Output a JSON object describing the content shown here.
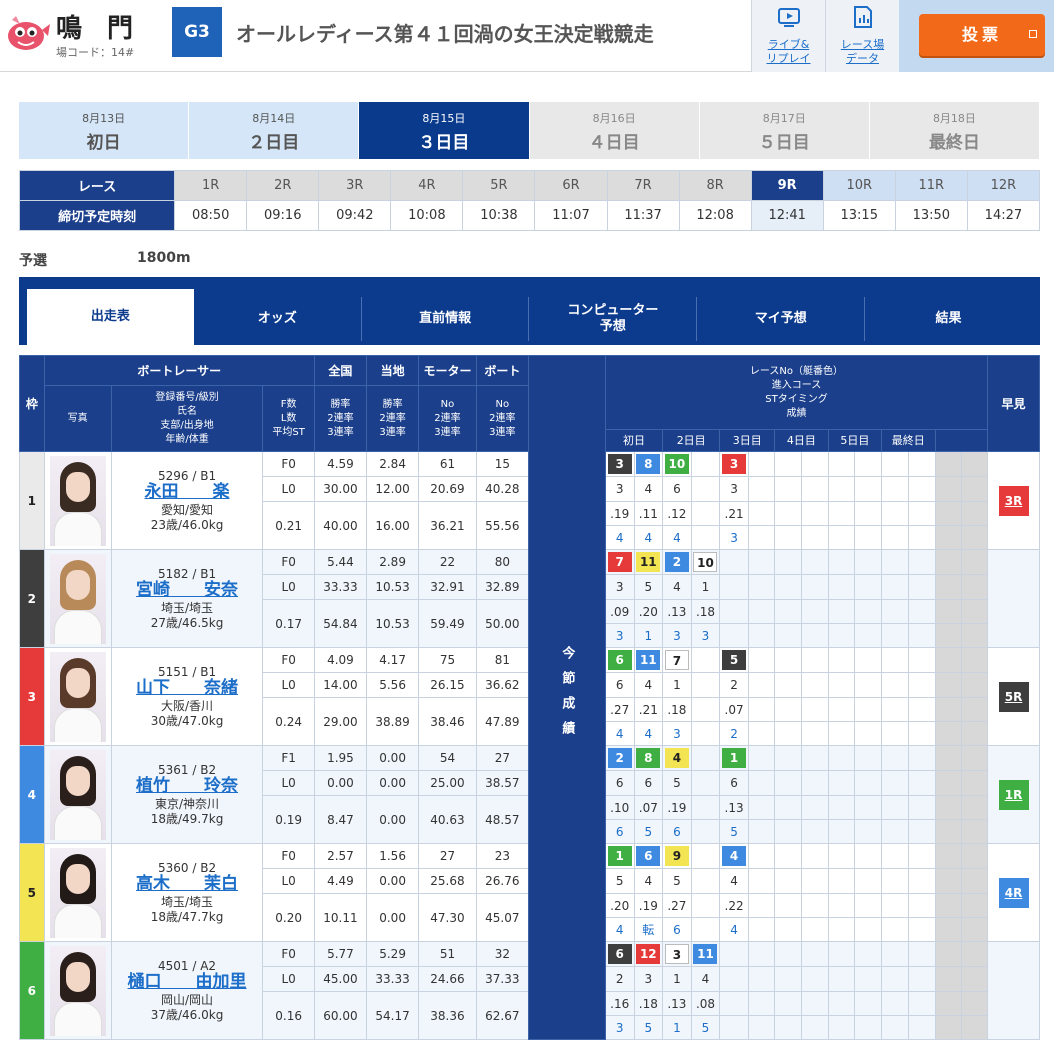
{
  "header": {
    "venue": "鳴 門",
    "venue_code": "場コード：14#",
    "grade": "G3",
    "race_title": "オールレディース第４１回渦の女王決定戦競走",
    "live_label1": "ライブ&",
    "live_label2": "リプレイ",
    "data_label1": "レース場",
    "data_label2": "データ",
    "vote_label": "投票"
  },
  "days": [
    {
      "date": "8月13日",
      "name": "初日",
      "state": "past"
    },
    {
      "date": "8月14日",
      "name": "２日目",
      "state": "past"
    },
    {
      "date": "8月15日",
      "name": "３日目",
      "state": "cur"
    },
    {
      "date": "8月16日",
      "name": "４日目",
      "state": "fut"
    },
    {
      "date": "8月17日",
      "name": "５日目",
      "state": "fut"
    },
    {
      "date": "8月18日",
      "name": "最終日",
      "state": "fut"
    }
  ],
  "races": {
    "race_label": "レース",
    "time_label": "締切予定時刻",
    "list": [
      {
        "r": "1R",
        "t": "08:50",
        "s": "past"
      },
      {
        "r": "2R",
        "t": "09:16",
        "s": "past"
      },
      {
        "r": "3R",
        "t": "09:42",
        "s": "past"
      },
      {
        "r": "4R",
        "t": "10:08",
        "s": "past"
      },
      {
        "r": "5R",
        "t": "10:38",
        "s": "past"
      },
      {
        "r": "6R",
        "t": "11:07",
        "s": "past"
      },
      {
        "r": "7R",
        "t": "11:37",
        "s": "past"
      },
      {
        "r": "8R",
        "t": "12:08",
        "s": "past"
      },
      {
        "r": "9R",
        "t": "12:41",
        "s": "cur"
      },
      {
        "r": "10R",
        "t": "13:15",
        "s": "fu"
      },
      {
        "r": "11R",
        "t": "13:50",
        "s": "fu"
      },
      {
        "r": "12R",
        "t": "14:27",
        "s": "fu"
      }
    ]
  },
  "race_info": {
    "type": "予選",
    "distance": "1800m"
  },
  "tabs": [
    "出走表",
    "オッズ",
    "直前情報",
    "コンピューター\n予想",
    "マイ予想",
    "結果"
  ],
  "table_head": {
    "waku": "枠",
    "boatracer": "ボートレーサー",
    "photo": "写真",
    "reg": "登録番号/級別",
    "name": "氏名",
    "branch": "支部/出身地",
    "age": "年齢/体重",
    "fcol": [
      "F数",
      "L数",
      "平均ST"
    ],
    "zenkoku": "全国",
    "touchi": "当地",
    "motor": "モーター",
    "boat": "ボート",
    "rate": [
      "勝率",
      "2連率",
      "3連率"
    ],
    "mrate": [
      "No",
      "2連率",
      "3連率"
    ],
    "race_no": [
      "レースNo（艇番色）",
      "進入コース",
      "STタイミング",
      "成績"
    ],
    "daycols": [
      "初日",
      "2日目",
      "3日目",
      "4日目",
      "5日目",
      "最終日"
    ],
    "hayami": "早見",
    "today": "今節成績"
  },
  "racers": [
    {
      "waku": "1",
      "reg": "5296 / B1",
      "name": "永田　　楽",
      "branch": "愛知/愛知",
      "age": "23歳/46.0kg",
      "f": "F0",
      "l": "L0",
      "st": "0.21",
      "zen": [
        "4.59",
        "30.00",
        "40.00"
      ],
      "tou": [
        "2.84",
        "12.00",
        "16.00"
      ],
      "mot": [
        "61",
        "20.69",
        "36.21"
      ],
      "boat": [
        "15",
        "40.28",
        "55.56"
      ],
      "res": [
        [
          "3",
          "8",
          "10",
          "",
          "3"
        ],
        [
          "3",
          "4",
          "6",
          "",
          "3"
        ],
        [
          ".19",
          ".11",
          ".12",
          "",
          ".21"
        ],
        [
          "4",
          "4",
          "4",
          "",
          "3"
        ]
      ],
      "boxc": [
        "b2",
        "b4",
        "b6",
        "",
        "b3"
      ],
      "hay": "3R",
      "hayc": "b3",
      "hair": "#3a2b22"
    },
    {
      "waku": "2",
      "reg": "5182 / B1",
      "name": "宮崎　　安奈",
      "branch": "埼玉/埼玉",
      "age": "27歳/46.5kg",
      "f": "F0",
      "l": "L0",
      "st": "0.17",
      "zen": [
        "5.44",
        "33.33",
        "54.84"
      ],
      "tou": [
        "2.89",
        "10.53",
        "10.53"
      ],
      "mot": [
        "22",
        "32.91",
        "59.49"
      ],
      "boat": [
        "80",
        "32.89",
        "50.00"
      ],
      "res": [
        [
          "7",
          "11",
          "2",
          "10",
          ""
        ],
        [
          "3",
          "5",
          "4",
          "1",
          ""
        ],
        [
          ".09",
          ".20",
          ".13",
          ".18",
          ""
        ],
        [
          "3",
          "1",
          "3",
          "3",
          ""
        ]
      ],
      "boxc": [
        "b3",
        "b5",
        "b4",
        "b1",
        ""
      ],
      "hay": "",
      "hayc": "",
      "hair": "#b88a5a"
    },
    {
      "waku": "3",
      "reg": "5151 / B1",
      "name": "山下　　奈緒",
      "branch": "大阪/香川",
      "age": "30歳/47.0kg",
      "f": "F0",
      "l": "L0",
      "st": "0.24",
      "zen": [
        "4.09",
        "14.00",
        "29.00"
      ],
      "tou": [
        "4.17",
        "5.56",
        "38.89"
      ],
      "mot": [
        "75",
        "26.15",
        "38.46"
      ],
      "boat": [
        "81",
        "36.62",
        "47.89"
      ],
      "res": [
        [
          "6",
          "11",
          "7",
          "",
          "5"
        ],
        [
          "6",
          "4",
          "1",
          "",
          "2"
        ],
        [
          ".27",
          ".21",
          ".18",
          "",
          ".07"
        ],
        [
          "4",
          "4",
          "3",
          "",
          "2"
        ]
      ],
      "boxc": [
        "b6",
        "b4",
        "b1",
        "",
        "b2"
      ],
      "hay": "5R",
      "hayc": "b2",
      "hair": "#5a3a28"
    },
    {
      "waku": "4",
      "reg": "5361 / B2",
      "name": "植竹　　玲奈",
      "branch": "東京/神奈川",
      "age": "18歳/49.7kg",
      "f": "F1",
      "l": "L0",
      "st": "0.19",
      "zen": [
        "1.95",
        "0.00",
        "8.47"
      ],
      "tou": [
        "0.00",
        "0.00",
        "0.00"
      ],
      "mot": [
        "54",
        "25.00",
        "40.63"
      ],
      "boat": [
        "27",
        "38.57",
        "48.57"
      ],
      "res": [
        [
          "2",
          "8",
          "4",
          "",
          "1"
        ],
        [
          "6",
          "6",
          "5",
          "",
          "6"
        ],
        [
          ".10",
          ".07",
          ".19",
          "",
          ".13"
        ],
        [
          "6",
          "5",
          "6",
          "",
          "5"
        ]
      ],
      "boxc": [
        "b4",
        "b6",
        "b5",
        "",
        "b6"
      ],
      "hay": "1R",
      "hayc": "b6",
      "hair": "#2a1f1a"
    },
    {
      "waku": "5",
      "reg": "5360 / B2",
      "name": "高木　　茉白",
      "branch": "埼玉/埼玉",
      "age": "18歳/47.7kg",
      "f": "F0",
      "l": "L0",
      "st": "0.20",
      "zen": [
        "2.57",
        "4.49",
        "10.11"
      ],
      "tou": [
        "1.56",
        "0.00",
        "0.00"
      ],
      "mot": [
        "27",
        "25.68",
        "47.30"
      ],
      "boat": [
        "23",
        "26.76",
        "45.07"
      ],
      "res": [
        [
          "1",
          "6",
          "9",
          "",
          "4"
        ],
        [
          "5",
          "4",
          "5",
          "",
          "4"
        ],
        [
          ".20",
          ".19",
          ".27",
          "",
          ".22"
        ],
        [
          "4",
          "転",
          "6",
          "",
          "4"
        ]
      ],
      "boxc": [
        "b6",
        "b4",
        "b5",
        "",
        "b4"
      ],
      "hay": "4R",
      "hayc": "b4",
      "hair": "#221a16"
    },
    {
      "waku": "6",
      "reg": "4501 / A2",
      "name": "樋口　　由加里",
      "branch": "岡山/岡山",
      "age": "37歳/46.0kg",
      "f": "F0",
      "l": "L0",
      "st": "0.16",
      "zen": [
        "5.77",
        "45.00",
        "60.00"
      ],
      "tou": [
        "5.29",
        "33.33",
        "54.17"
      ],
      "mot": [
        "51",
        "24.66",
        "38.36"
      ],
      "boat": [
        "32",
        "37.33",
        "62.67"
      ],
      "res": [
        [
          "6",
          "12",
          "3",
          "11",
          ""
        ],
        [
          "2",
          "3",
          "1",
          "4",
          ""
        ],
        [
          ".16",
          ".18",
          ".13",
          ".08",
          ""
        ],
        [
          "3",
          "5",
          "1",
          "5",
          ""
        ]
      ],
      "boxc": [
        "b2",
        "b3",
        "b1",
        "b4",
        ""
      ],
      "hay": "",
      "hayc": "",
      "hair": "#2a1f1a"
    }
  ]
}
